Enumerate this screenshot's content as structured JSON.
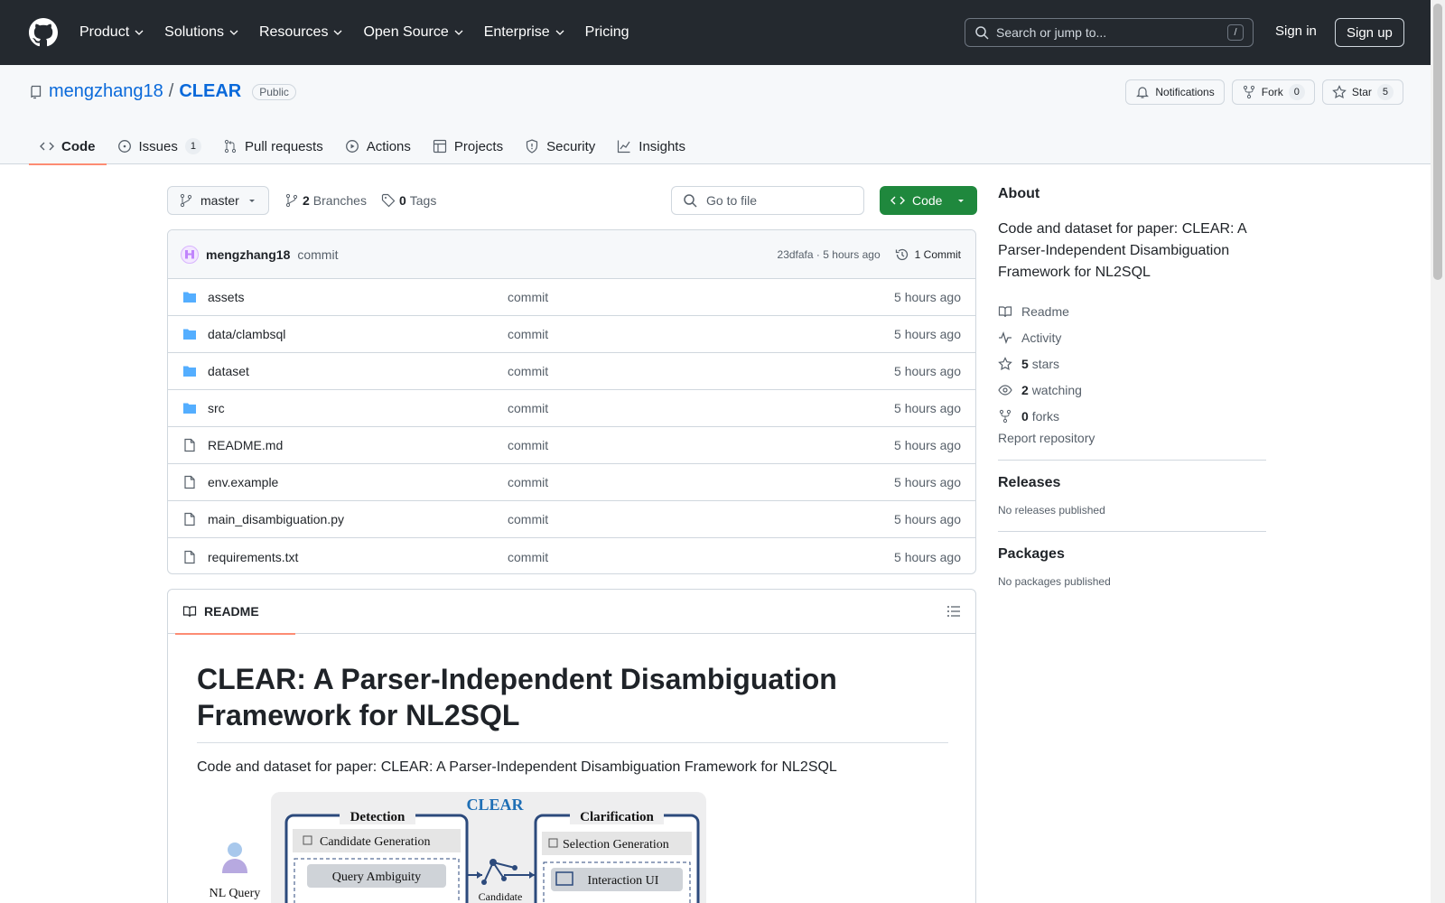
{
  "header": {
    "nav": [
      "Product",
      "Solutions",
      "Resources",
      "Open Source",
      "Enterprise",
      "Pricing"
    ],
    "search_placeholder": "Search or jump to...",
    "search_key": "/",
    "signin": "Sign in",
    "signup": "Sign up"
  },
  "repo": {
    "owner": "mengzhang18",
    "sep": "/",
    "name": "CLEAR",
    "visibility": "Public",
    "notifications": "Notifications",
    "fork_label": "Fork",
    "fork_count": "0",
    "star_label": "Star",
    "star_count": "5",
    "tabs": [
      {
        "label": "Code",
        "icon": "code-icon"
      },
      {
        "label": "Issues",
        "icon": "issue-icon",
        "count": "1"
      },
      {
        "label": "Pull requests",
        "icon": "pull-request-icon"
      },
      {
        "label": "Actions",
        "icon": "play-icon"
      },
      {
        "label": "Projects",
        "icon": "table-icon"
      },
      {
        "label": "Security",
        "icon": "shield-icon"
      },
      {
        "label": "Insights",
        "icon": "graph-icon"
      }
    ]
  },
  "toolbar": {
    "branch": "master",
    "branches_count": "2",
    "branches_label": "Branches",
    "tags_count": "0",
    "tags_label": "Tags",
    "goto_placeholder": "Go to file",
    "code_label": "Code"
  },
  "commit": {
    "author": "mengzhang18",
    "message": "commit",
    "hash": "23dfafa",
    "dot": "·",
    "time": "5 hours ago",
    "count": "1 Commit"
  },
  "files": [
    {
      "name": "assets",
      "type": "folder",
      "message": "commit",
      "time": "5 hours ago"
    },
    {
      "name": "data/clambsql",
      "type": "folder",
      "message": "commit",
      "time": "5 hours ago"
    },
    {
      "name": "dataset",
      "type": "folder",
      "message": "commit",
      "time": "5 hours ago"
    },
    {
      "name": "src",
      "type": "folder",
      "message": "commit",
      "time": "5 hours ago"
    },
    {
      "name": "README.md",
      "type": "file",
      "message": "commit",
      "time": "5 hours ago"
    },
    {
      "name": "env.example",
      "type": "file",
      "message": "commit",
      "time": "5 hours ago"
    },
    {
      "name": "main_disambiguation.py",
      "type": "file",
      "message": "commit",
      "time": "5 hours ago"
    },
    {
      "name": "requirements.txt",
      "type": "file",
      "message": "commit",
      "time": "5 hours ago"
    }
  ],
  "readme": {
    "tab": "README",
    "title": "CLEAR: A Parser-Independent Disambiguation Framework for NL2SQL",
    "description": "Code and dataset for paper: CLEAR: A Parser-Independent Disambiguation Framework for NL2SQL",
    "diagram": {
      "title": "CLEAR",
      "detection": "Detection",
      "candidate_generation": "Candidate Generation",
      "query_ambiguity": "Query Ambiguity",
      "clarification": "Clarification",
      "selection_generation": "Selection Generation",
      "interaction_ui": "Interaction UI",
      "nl_query": "NL Query",
      "candidate": "Candidate"
    }
  },
  "sidebar": {
    "about_title": "About",
    "about_desc": "Code and dataset for paper: CLEAR: A Parser-Independent Disambiguation Framework for NL2SQL",
    "readme": "Readme",
    "activity": "Activity",
    "stars_count": "5",
    "stars_label": "stars",
    "watching_count": "2",
    "watching_label": "watching",
    "forks_count": "0",
    "forks_label": "forks",
    "report": "Report repository",
    "releases_title": "Releases",
    "releases_empty": "No releases published",
    "packages_title": "Packages",
    "packages_empty": "No packages published"
  },
  "colors": {
    "header_bg": "#24292f",
    "accent_blue": "#0969da",
    "code_green": "#1f883d",
    "tab_underline": "#fd8c73",
    "folder_blue": "#54aeff"
  }
}
